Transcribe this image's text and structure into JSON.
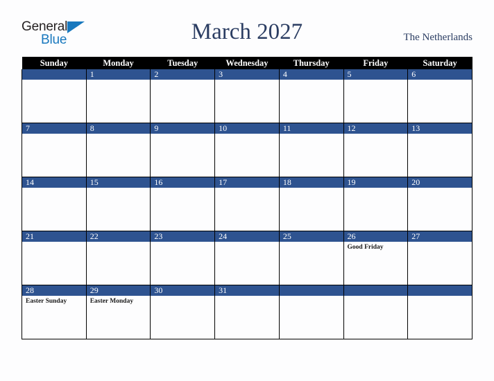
{
  "logo": {
    "word_one": "General",
    "word_two": "Blue",
    "triangle_icon": "triangle-icon"
  },
  "header": {
    "title": "March 2027",
    "country": "The Netherlands"
  },
  "colors": {
    "day_header_bg": "#000000",
    "day_header_text": "#ffffff",
    "date_bar_bg": "#2e5390",
    "date_bar_text": "#ffffff",
    "title_text": "#2b3d62",
    "cell_bg": "#fdfdfe",
    "grid_line": "#000000",
    "logo_blue": "#1878be",
    "logo_dark": "#231f20"
  },
  "weekdays": [
    "Sunday",
    "Monday",
    "Tuesday",
    "Wednesday",
    "Thursday",
    "Friday",
    "Saturday"
  ],
  "weeks": [
    [
      {
        "date": "",
        "events": []
      },
      {
        "date": "1",
        "events": []
      },
      {
        "date": "2",
        "events": []
      },
      {
        "date": "3",
        "events": []
      },
      {
        "date": "4",
        "events": []
      },
      {
        "date": "5",
        "events": []
      },
      {
        "date": "6",
        "events": []
      }
    ],
    [
      {
        "date": "7",
        "events": []
      },
      {
        "date": "8",
        "events": []
      },
      {
        "date": "9",
        "events": []
      },
      {
        "date": "10",
        "events": []
      },
      {
        "date": "11",
        "events": []
      },
      {
        "date": "12",
        "events": []
      },
      {
        "date": "13",
        "events": []
      }
    ],
    [
      {
        "date": "14",
        "events": []
      },
      {
        "date": "15",
        "events": []
      },
      {
        "date": "16",
        "events": []
      },
      {
        "date": "17",
        "events": []
      },
      {
        "date": "18",
        "events": []
      },
      {
        "date": "19",
        "events": []
      },
      {
        "date": "20",
        "events": []
      }
    ],
    [
      {
        "date": "21",
        "events": []
      },
      {
        "date": "22",
        "events": []
      },
      {
        "date": "23",
        "events": []
      },
      {
        "date": "24",
        "events": []
      },
      {
        "date": "25",
        "events": []
      },
      {
        "date": "26",
        "events": [
          "Good Friday"
        ]
      },
      {
        "date": "27",
        "events": []
      }
    ],
    [
      {
        "date": "28",
        "events": [
          "Easter Sunday"
        ]
      },
      {
        "date": "29",
        "events": [
          "Easter Monday"
        ]
      },
      {
        "date": "30",
        "events": []
      },
      {
        "date": "31",
        "events": []
      },
      {
        "date": "",
        "events": []
      },
      {
        "date": "",
        "events": []
      },
      {
        "date": "",
        "events": []
      }
    ]
  ]
}
